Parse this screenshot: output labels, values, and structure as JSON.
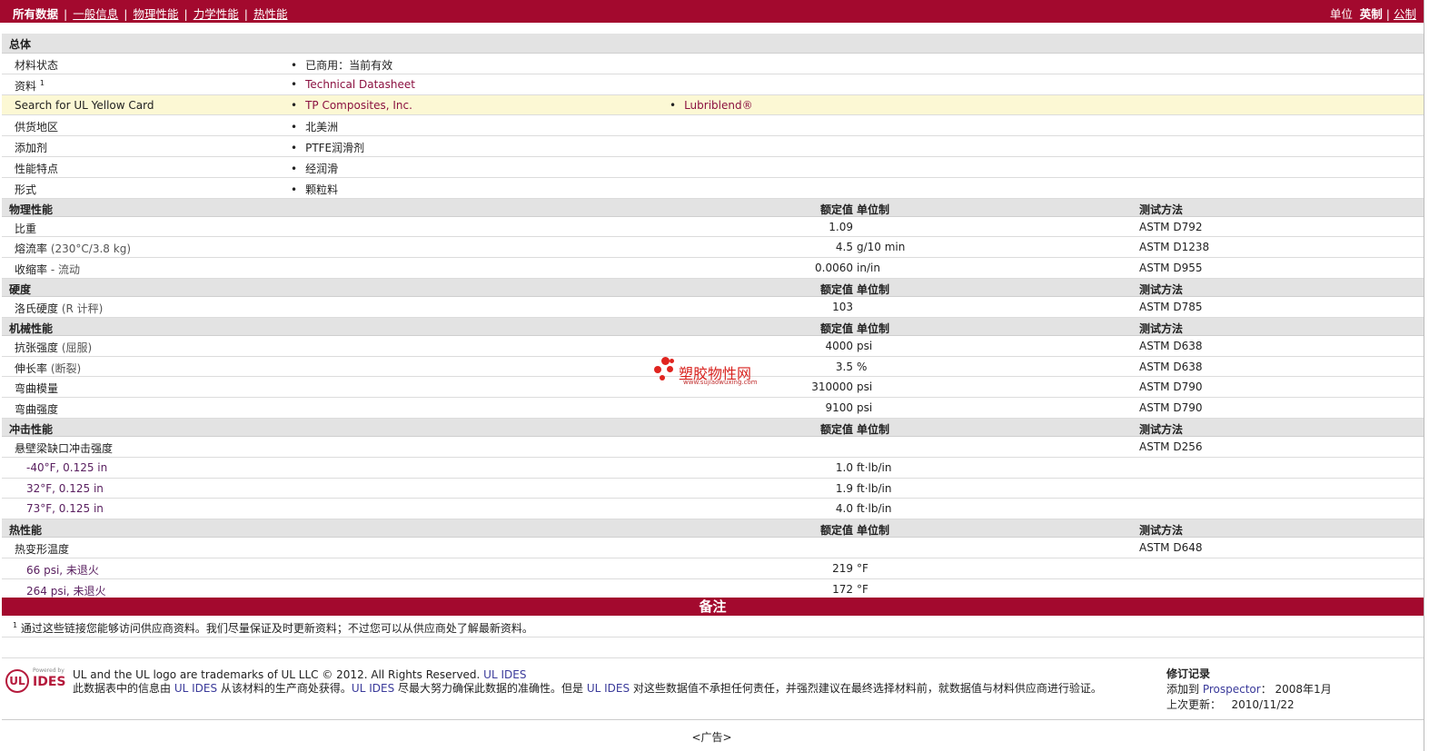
{
  "nav": {
    "current": "所有数据",
    "links": [
      "一般信息",
      "物理性能",
      "力学性能",
      "热性能"
    ],
    "sep": "|"
  },
  "units": {
    "label": "单位",
    "selected": "英制",
    "sep": "|",
    "other": "公制"
  },
  "general": {
    "title": "总体",
    "rows": [
      {
        "label": "材料状态",
        "v1": "已商用：当前有效"
      },
      {
        "label": "资料",
        "sup": "1",
        "v1": "Technical Datasheet"
      },
      {
        "label": "Search for UL Yellow Card",
        "v1": "TP Composites, Inc.",
        "v2": "Lubriblend®"
      },
      {
        "label": "供货地区",
        "v1": "北美洲"
      },
      {
        "label": "添加剂",
        "v1": "PTFE润滑剂"
      },
      {
        "label": "性能特点",
        "v1": "经润滑"
      },
      {
        "label": "形式",
        "v1": "颗粒料"
      }
    ]
  },
  "headers": {
    "rated": "额定值",
    "unit": "单位制",
    "method": "测试方法"
  },
  "physical": {
    "title": "物理性能",
    "rows": [
      {
        "label": "比重",
        "value": "1.09",
        "unit": "",
        "method": "ASTM D792"
      },
      {
        "label": "熔流率",
        "cond": "(230°C/3.8 kg)",
        "value": "4.5",
        "unit": "g/10 min",
        "method": "ASTM D1238"
      },
      {
        "label": "收缩率",
        "cond": "- 流动",
        "value": "0.0060",
        "unit": "in/in",
        "method": "ASTM D955"
      }
    ]
  },
  "hardness": {
    "title": "硬度",
    "rows": [
      {
        "label": "洛氏硬度",
        "cond": "(R 计秤)",
        "value": "103",
        "unit": "",
        "method": "ASTM D785"
      }
    ]
  },
  "mechanical": {
    "title": "机械性能",
    "rows": [
      {
        "label": "抗张强度",
        "cond": "(屈服)",
        "value": "4000",
        "unit": "psi",
        "method": "ASTM D638"
      },
      {
        "label": "伸长率",
        "cond": "(断裂)",
        "value": "3.5",
        "unit": "%",
        "method": "ASTM D638"
      },
      {
        "label": "弯曲模量",
        "value": "310000",
        "unit": "psi",
        "method": "ASTM D790"
      },
      {
        "label": "弯曲强度",
        "value": "9100",
        "unit": "psi",
        "method": "ASTM D790"
      }
    ]
  },
  "impact": {
    "title": "冲击性能",
    "main": {
      "label": "悬壁梁缺口冲击强度",
      "method": "ASTM D256"
    },
    "rows": [
      {
        "label": "-40°F, 0.125 in",
        "value": "1.0",
        "unit": "ft·lb/in"
      },
      {
        "label": "32°F, 0.125 in",
        "value": "1.9",
        "unit": "ft·lb/in"
      },
      {
        "label": "73°F, 0.125 in",
        "value": "4.0",
        "unit": "ft·lb/in"
      }
    ]
  },
  "thermal": {
    "title": "热性能",
    "main": {
      "label": "热变形温度",
      "method": "ASTM D648"
    },
    "rows": [
      {
        "label": "66 psi, 未退火",
        "value": "219",
        "unit": "°F"
      },
      {
        "label": "264 psi, 未退火",
        "value": "172",
        "unit": "°F"
      }
    ]
  },
  "notes": {
    "title": "备注",
    "sup": "1",
    "text": "通过这些链接您能够访问供应商资料。我们尽量保证及时更新资料；不过您可以从供应商处了解最新资料。"
  },
  "footer": {
    "logo_circle": "UL",
    "logo_powered": "Powered by",
    "logo_text": "IDES",
    "line1_a": "UL and the UL logo are trademarks of UL LLC © 2012. All Rights Reserved. ",
    "line1_b": "UL IDES",
    "line2_a": "此数据表中的信息由 ",
    "line2_b": "UL IDES",
    "line2_c": " 从该材料的生产商处获得。",
    "line2_d": "UL IDES",
    "line2_e": " 尽最大努力确保此数据的准确性。但是 ",
    "line2_f": "UL IDES",
    "line2_g": " 对这些数据值不承担任何责任，并强烈建议在最终选择材料前，就数据值与材料供应商进行验证。",
    "rev_title": "修订记录",
    "rev_added_label": "添加到 ",
    "rev_added_site": "Prospector",
    "rev_added_date": "：   2008年1月",
    "rev_updated_label": "上次更新：",
    "rev_updated_date": "2010/11/22",
    "ad": "<广告>"
  },
  "watermark": {
    "name": "塑胶物性网",
    "url": "www.sujiaowuxing.com"
  }
}
